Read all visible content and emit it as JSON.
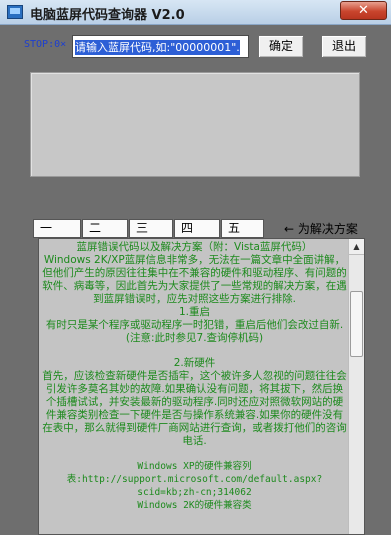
{
  "window": {
    "title": "电脑蓝屏代码查询器 V2.0",
    "close_label": "✕"
  },
  "toolbar": {
    "stop_prefix": "STOP:0×",
    "code_input_value": "请输入蓝屏代码,如:\"00000001\".",
    "confirm_label": "确定",
    "exit_label": "退出"
  },
  "tabs": [
    "一",
    "二",
    "三",
    "四",
    "五"
  ],
  "tabs_hint": "← 为解决方案",
  "content": {
    "lines": [
      "蓝屏错误代码以及解决方案（附：Vista蓝屏代码）",
      "Windows 2K/XP蓝屏信息非常多，无法在一篇文章中全面讲解，但他们产生的原因往往集中在不兼容的硬件和驱动程序、有问题的软件、病毒等，因此首先为大家提供了一些常规的解决方案，在遇到蓝屏错误时，应先对照这些方案进行排除.",
      "1.重启",
      "有时只是某个程序或驱动程序一时犯错，重启后他们会改过自新.(注意:此时参见7.查询停机码)",
      "",
      "2.新硬件",
      "首先，应该检查新硬件是否插牢，这个被许多人忽视的问题往往会引发许多莫名其妙的故障.如果确认没有问题，将其拔下，然后换个插槽试试，并安装最新的驱动程序.同时还应对照微软网站的硬件兼容类别检查一下硬件是否与操作系统兼容.如果你的硬件没有在表中，那么就得到硬件厂商网站进行查询，或者拨打他们的咨询电话.",
      "",
      "Windows XP的硬件兼容列表:http://support.microsoft.com/default.aspx?scid=kb;zh-cn;314062",
      "Windows 2K的硬件兼容类"
    ]
  },
  "icons": {
    "app": "app-window-icon",
    "scroll_up": "scroll-up-arrow-icon"
  }
}
